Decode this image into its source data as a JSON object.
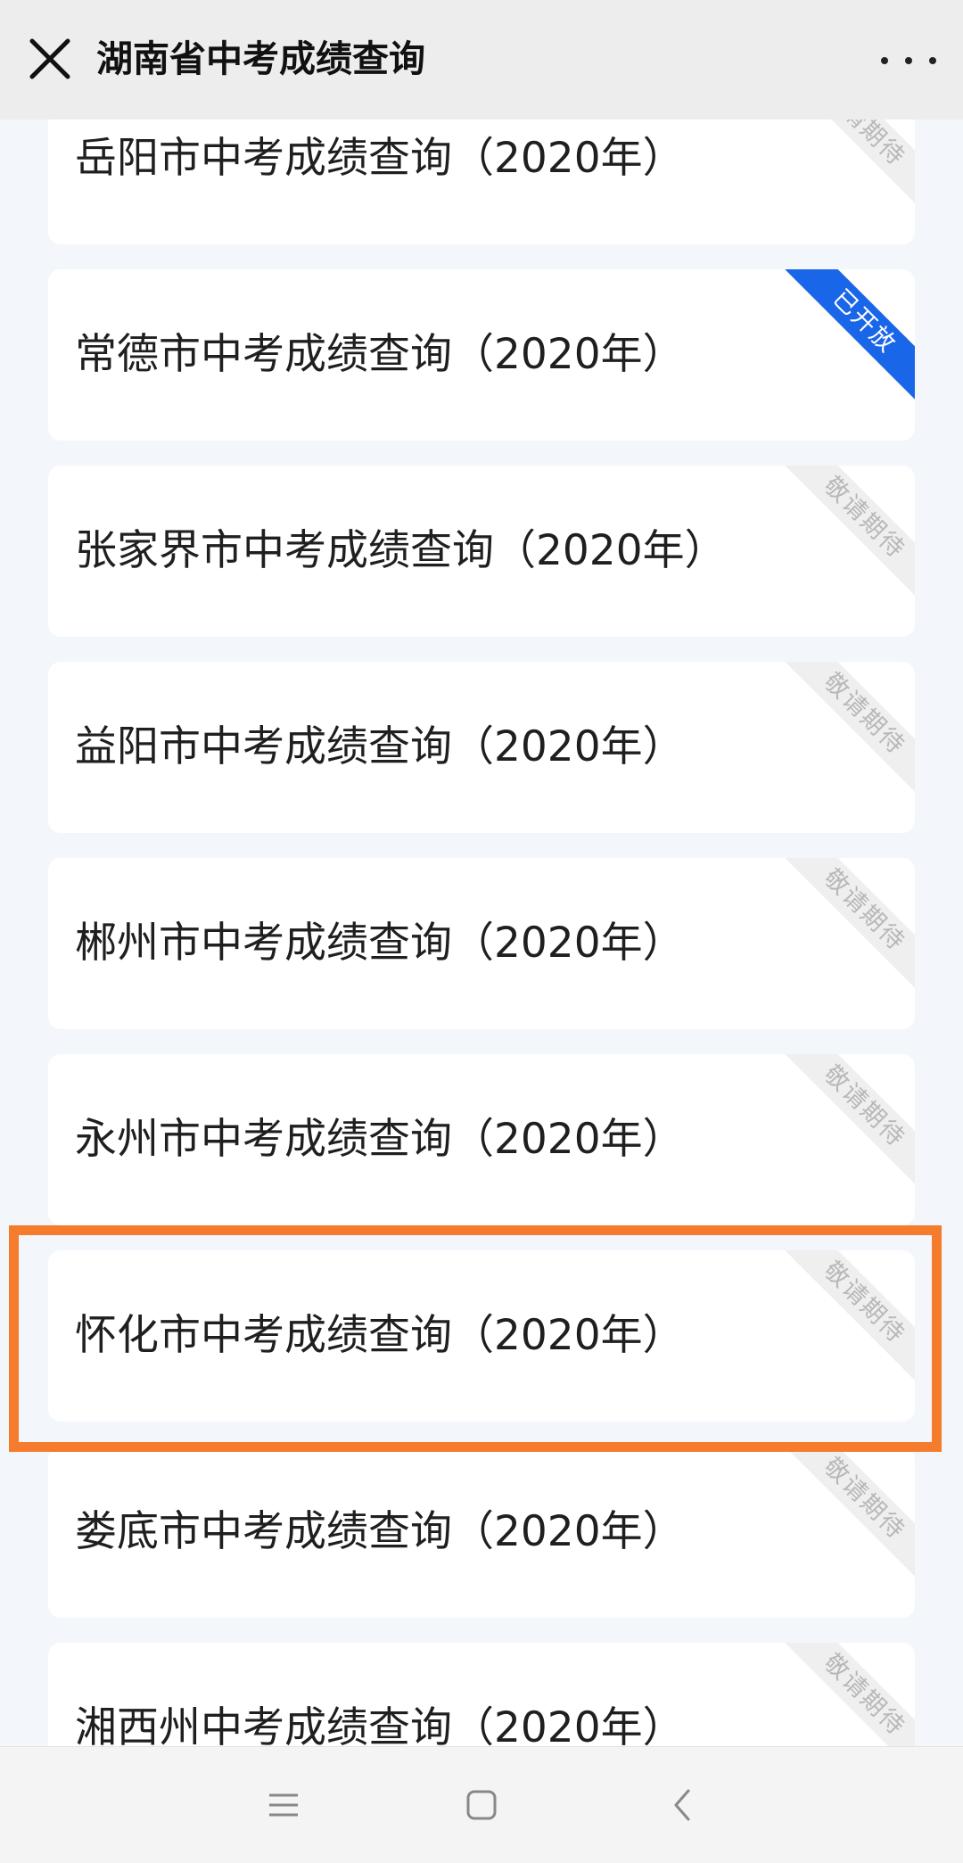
{
  "header": {
    "title": "湖南省中考成绩查询",
    "close_icon": "close-icon",
    "more_icon": "more-dots-icon"
  },
  "cards": [
    {
      "label": "岳阳市中考成绩查询（2020年）",
      "ribbon": "敬请期待",
      "status": "pending"
    },
    {
      "label": "常德市中考成绩查询（2020年）",
      "ribbon": "已开放",
      "status": "open"
    },
    {
      "label": "张家界市中考成绩查询（2020年）",
      "ribbon": "敬请期待",
      "status": "pending"
    },
    {
      "label": "益阳市中考成绩查询（2020年）",
      "ribbon": "敬请期待",
      "status": "pending"
    },
    {
      "label": "郴州市中考成绩查询（2020年）",
      "ribbon": "敬请期待",
      "status": "pending"
    },
    {
      "label": "永州市中考成绩查询（2020年）",
      "ribbon": "敬请期待",
      "status": "pending"
    },
    {
      "label": "怀化市中考成绩查询（2020年）",
      "ribbon": "敬请期待",
      "status": "pending",
      "highlighted": true
    },
    {
      "label": "娄底市中考成绩查询（2020年）",
      "ribbon": "敬请期待",
      "status": "pending"
    },
    {
      "label": "湘西州中考成绩查询（2020年）",
      "ribbon": "敬请期待",
      "status": "pending"
    }
  ],
  "colors": {
    "open_ribbon": "#1a66e8",
    "pending_ribbon": "#efefef",
    "highlight_border": "#f47c2c"
  },
  "navbar": {
    "menu_icon": "menu-icon",
    "home_icon": "home-square-icon",
    "back_icon": "back-chevron-icon"
  }
}
